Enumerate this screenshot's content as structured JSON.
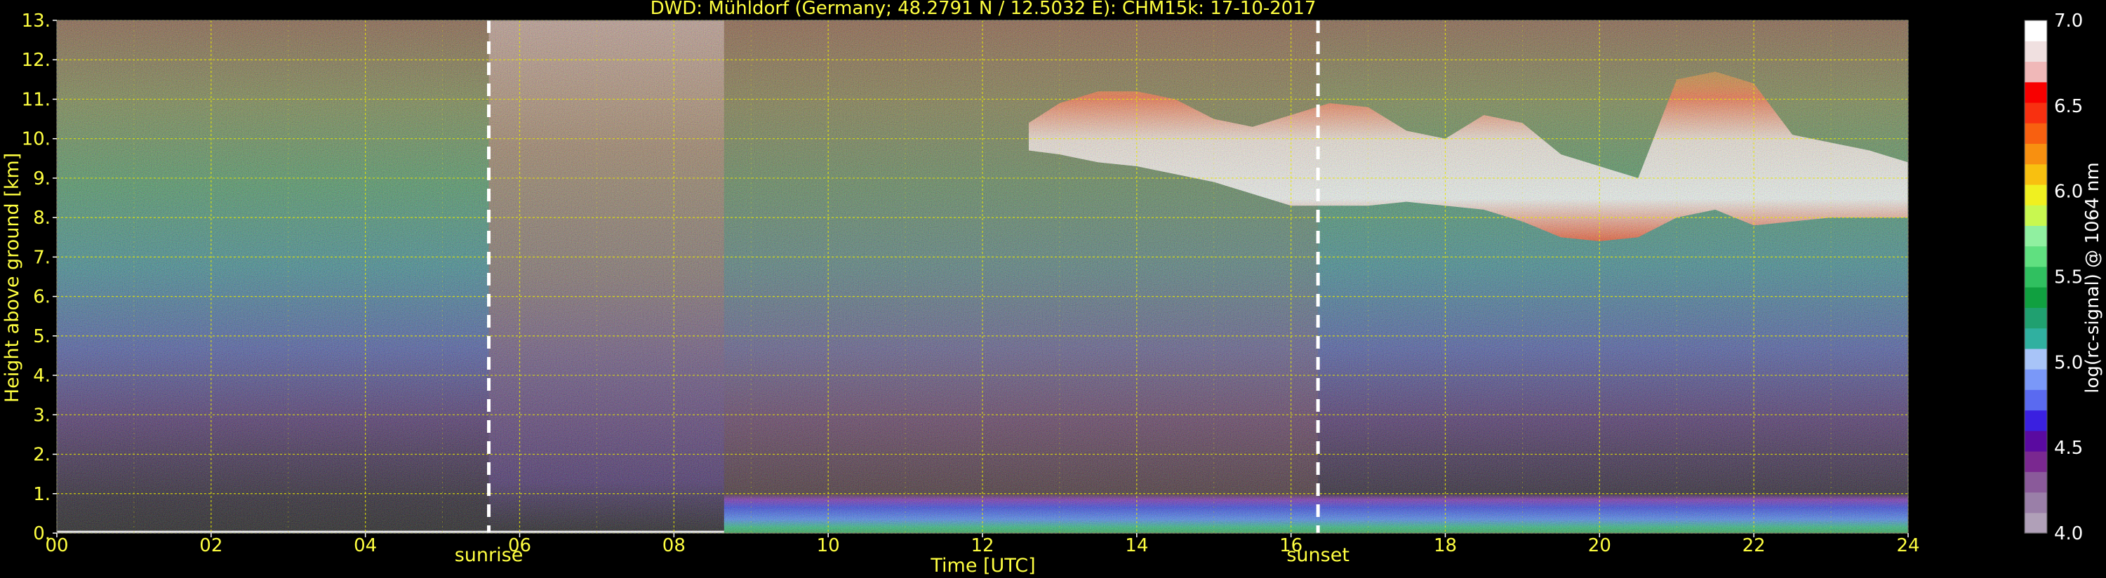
{
  "chart_data": {
    "type": "heatmap",
    "title": "DWD: Mühldorf (Germany; 48.2791 N / 12.5032 E):    CHM15k: 17-10-2017",
    "xlabel": "Time [UTC]",
    "ylabel": "Height above ground [km]",
    "xlim": [
      0,
      24
    ],
    "ylim": [
      0,
      13
    ],
    "x_ticks": [
      "00",
      "02",
      "04",
      "06",
      "08",
      "10",
      "12",
      "14",
      "16",
      "18",
      "20",
      "22",
      "24"
    ],
    "y_ticks": [
      "0.",
      "1.",
      "2.",
      "3.",
      "4.",
      "5.",
      "6.",
      "7.",
      "8.",
      "9.",
      "10.",
      "11.",
      "12.",
      "13."
    ],
    "grid": true,
    "colorbar": {
      "label": "log(rc-signal) @ 1064 nm",
      "range": [
        4.0,
        7.0
      ],
      "ticks": [
        "4.0",
        "4.5",
        "5.0",
        "5.5",
        "6.0",
        "6.5",
        "7.0"
      ],
      "colors": [
        "#b0a0b8",
        "#9a7fa8",
        "#8a5a9a",
        "#7a2890",
        "#5a0aa0",
        "#3a20e0",
        "#5a6af0",
        "#7a98f8",
        "#a8c4f8",
        "#30b0a0",
        "#20a070",
        "#10a040",
        "#30c060",
        "#60e080",
        "#90f0a0",
        "#c8f850",
        "#f0f020",
        "#f8c010",
        "#f89010",
        "#f86010",
        "#f83010",
        "#f80000",
        "#f0b8b8",
        "#f0e0e0",
        "#ffffff"
      ]
    },
    "annotations": [
      {
        "label": "sunrise",
        "x": 5.6
      },
      {
        "label": "sunset",
        "x": 16.35
      }
    ],
    "boundary_layer_change_time": 8.65,
    "cloud_layer": [
      {
        "x": 12.6,
        "base": 9.7,
        "top": 10.4
      },
      {
        "x": 13.0,
        "base": 9.6,
        "top": 10.9
      },
      {
        "x": 13.5,
        "base": 9.4,
        "top": 11.2
      },
      {
        "x": 14.0,
        "base": 9.3,
        "top": 11.2
      },
      {
        "x": 14.5,
        "base": 9.1,
        "top": 11.0
      },
      {
        "x": 15.0,
        "base": 8.9,
        "top": 10.5
      },
      {
        "x": 15.5,
        "base": 8.6,
        "top": 10.3
      },
      {
        "x": 16.0,
        "base": 8.3,
        "top": 10.6
      },
      {
        "x": 16.5,
        "base": 8.3,
        "top": 10.9
      },
      {
        "x": 17.0,
        "base": 8.3,
        "top": 10.8
      },
      {
        "x": 17.5,
        "base": 8.4,
        "top": 10.2
      },
      {
        "x": 18.0,
        "base": 8.3,
        "top": 10.0
      },
      {
        "x": 18.5,
        "base": 8.2,
        "top": 10.6
      },
      {
        "x": 19.0,
        "base": 7.9,
        "top": 10.4
      },
      {
        "x": 19.5,
        "base": 7.5,
        "top": 9.6
      },
      {
        "x": 20.0,
        "base": 7.4,
        "top": 9.3
      },
      {
        "x": 20.5,
        "base": 7.5,
        "top": 9.0
      },
      {
        "x": 21.0,
        "base": 8.0,
        "top": 11.5
      },
      {
        "x": 21.5,
        "base": 8.2,
        "top": 11.7
      },
      {
        "x": 22.0,
        "base": 7.8,
        "top": 11.4
      },
      {
        "x": 22.5,
        "base": 7.9,
        "top": 10.1
      },
      {
        "x": 23.0,
        "base": 8.0,
        "top": 9.9
      },
      {
        "x": 23.5,
        "base": 8.0,
        "top": 9.7
      },
      {
        "x": 24.0,
        "base": 8.0,
        "top": 9.4
      }
    ]
  },
  "colors": {
    "text": "#ffff40",
    "grid": "#e8e800",
    "colorbar_text": "#ffffff",
    "marker_line": "#ffffff"
  }
}
